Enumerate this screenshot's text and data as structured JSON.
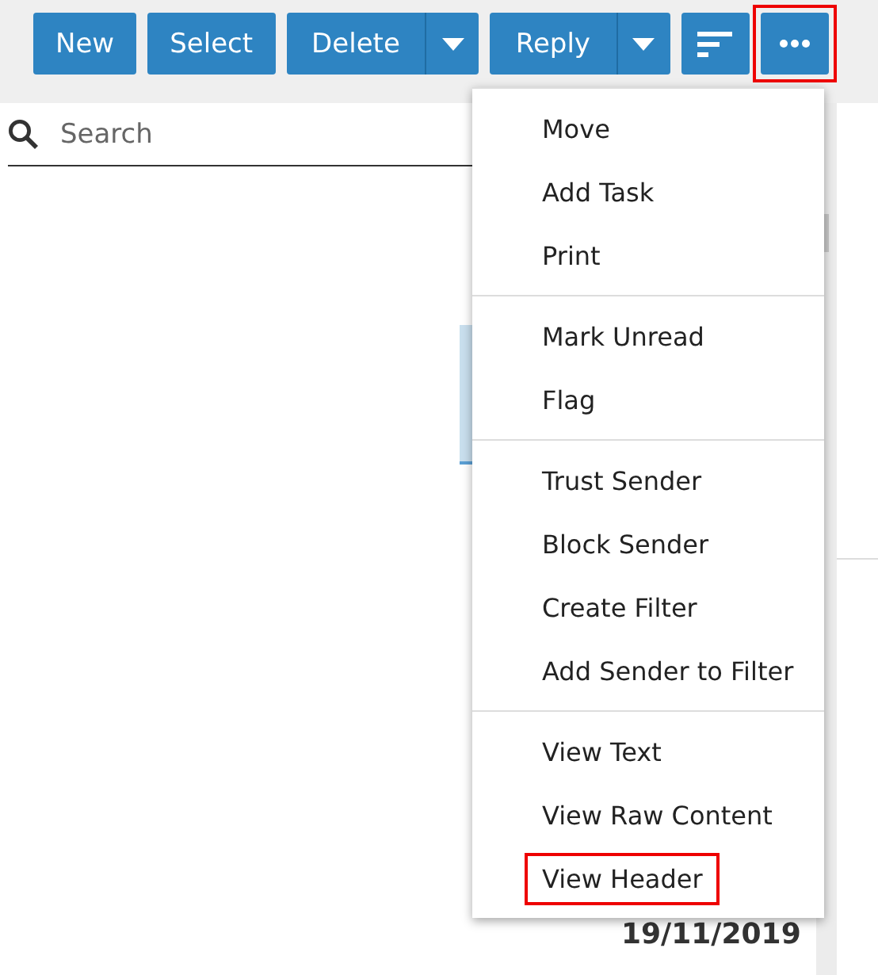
{
  "toolbar": {
    "buttons": [
      {
        "label": "New",
        "kind": "plain"
      },
      {
        "label": "Select",
        "kind": "plain"
      },
      {
        "label": "Delete",
        "kind": "split"
      },
      {
        "label": "Reply",
        "kind": "split"
      },
      {
        "kind": "sort"
      },
      {
        "kind": "more",
        "highlighted": true
      }
    ]
  },
  "search": {
    "placeholder": "Search"
  },
  "list": {
    "rows": [
      {
        "selected": true
      }
    ],
    "date": "19/11/2019"
  },
  "menu": {
    "groups": [
      [
        {
          "label": "Move",
          "highlighted": false
        },
        {
          "label": "Add Task",
          "highlighted": false
        },
        {
          "label": "Print",
          "highlighted": false
        }
      ],
      [
        {
          "label": "Mark Unread",
          "highlighted": false
        },
        {
          "label": "Flag",
          "highlighted": false
        }
      ],
      [
        {
          "label": "Trust Sender",
          "highlighted": false
        },
        {
          "label": "Block Sender",
          "highlighted": false
        },
        {
          "label": "Create Filter",
          "highlighted": false
        },
        {
          "label": "Add Sender to Filter",
          "highlighted": false
        }
      ],
      [
        {
          "label": "View Text",
          "highlighted": false
        },
        {
          "label": "View Raw Content",
          "highlighted": false
        },
        {
          "label": "View Header",
          "highlighted": true
        }
      ]
    ]
  }
}
